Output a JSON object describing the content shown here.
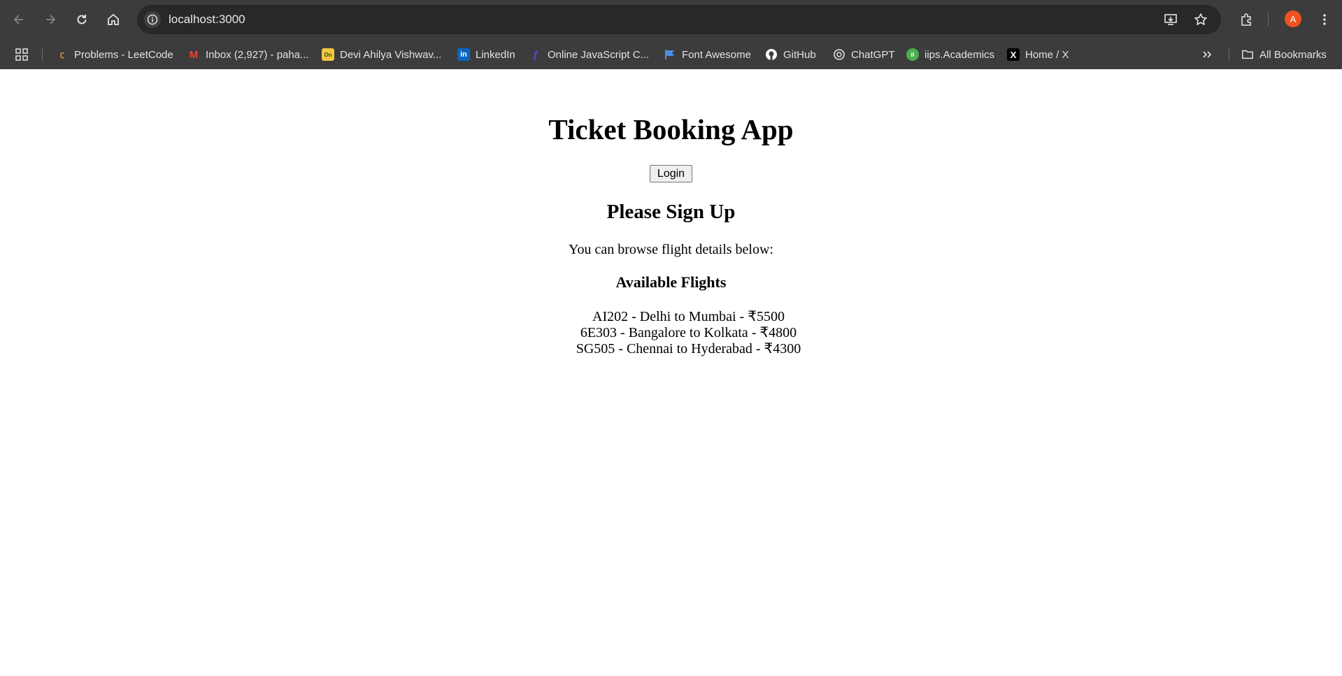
{
  "browser": {
    "url": "localhost:3000",
    "avatar_letter": "A",
    "bookmarks": [
      {
        "label": "Problems - LeetCode",
        "icon": "leetcode-icon",
        "color": "#f89f1b"
      },
      {
        "label": "Inbox (2,927) - paha...",
        "icon": "gmail-icon",
        "color": "#ea4335"
      },
      {
        "label": "Devi Ahilya Vishwav...",
        "icon": "online-icon",
        "color": "#f5c542"
      },
      {
        "label": "LinkedIn",
        "icon": "linkedin-icon",
        "color": "#0a66c2"
      },
      {
        "label": "Online JavaScript C...",
        "icon": "programiz-icon",
        "color": "#6a3df0"
      },
      {
        "label": "Font Awesome",
        "icon": "flag-icon",
        "color": "#4a90e2"
      },
      {
        "label": "GitHub",
        "icon": "github-icon",
        "color": "#ffffff"
      },
      {
        "label": "ChatGPT",
        "icon": "chatgpt-icon",
        "color": "#ffffff"
      },
      {
        "label": "iips.Academics",
        "icon": "iips-icon",
        "color": "#4caf50"
      },
      {
        "label": "Home / X",
        "icon": "x-icon",
        "color": "#000000"
      }
    ],
    "all_bookmarks_label": "All Bookmarks"
  },
  "app": {
    "title": "Ticket Booking App",
    "login_label": "Login",
    "signup_heading": "Please Sign Up",
    "browse_text": "You can browse flight details below:",
    "flights_heading": "Available Flights",
    "flights": [
      "AI202 - Delhi to Mumbai - ₹5500",
      "6E303 - Bangalore to Kolkata - ₹4800",
      "SG505 - Chennai to Hyderabad - ₹4300"
    ]
  }
}
